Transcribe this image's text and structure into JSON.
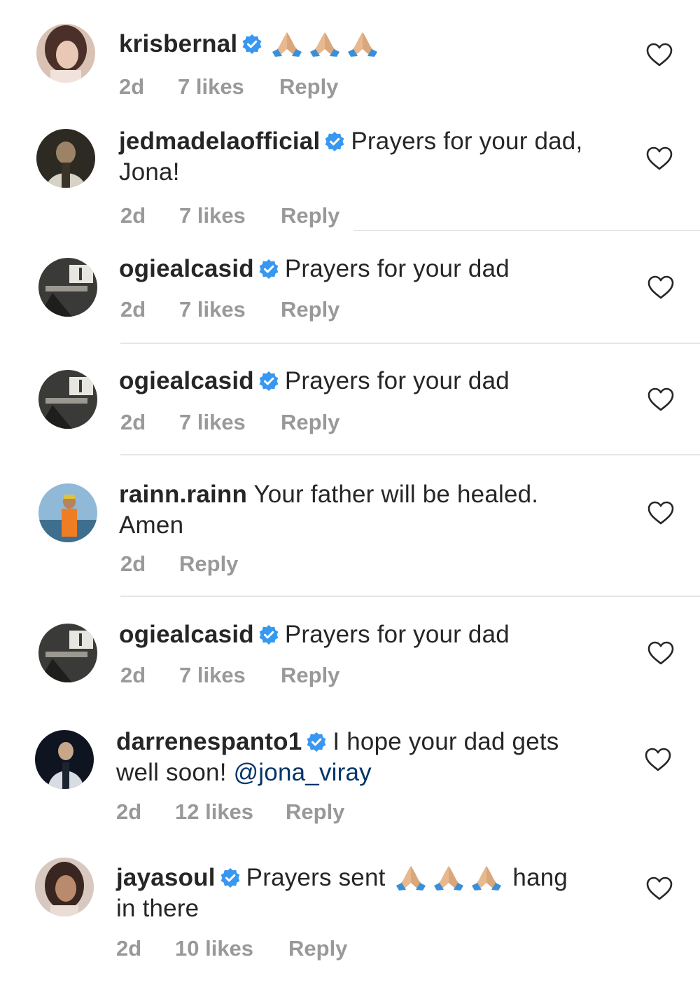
{
  "colors": {
    "username": "#262626",
    "meta": "#999999",
    "verified": "#3897f0",
    "mention": "#003569",
    "divider": "#e6e6e6"
  },
  "icons": {
    "verified": "verified-badge-icon",
    "like": "heart-outline-icon",
    "emoji": "folded-hands-emoji-icon"
  },
  "comments": [
    {
      "username": "krisbernal",
      "verified": true,
      "text": "",
      "emoji_count": 3,
      "time": "2d",
      "likes": "7 likes",
      "reply": "Reply"
    },
    {
      "username": "jedmadelaofficial",
      "verified": true,
      "text": "Prayers for your dad, Jona!",
      "time": "2d",
      "likes": "7 likes",
      "reply": "Reply"
    },
    {
      "username": "ogiealcasid",
      "verified": true,
      "text": "Prayers for your dad",
      "time": "2d",
      "likes": "7 likes",
      "reply": "Reply"
    },
    {
      "username": "ogiealcasid",
      "verified": true,
      "text": "Prayers for your dad",
      "time": "2d",
      "likes": "7 likes",
      "reply": "Reply"
    },
    {
      "username": "rainn.rainn",
      "verified": false,
      "text": "Your father will be healed. Amen",
      "time": "2d",
      "reply": "Reply"
    },
    {
      "username": "ogiealcasid",
      "verified": true,
      "text": "Prayers for your dad",
      "time": "2d",
      "likes": "7 likes",
      "reply": "Reply"
    },
    {
      "username": "darrenespanto1",
      "verified": true,
      "text": "I hope your dad gets well soon!",
      "mention": "@jona_viray",
      "time": "2d",
      "likes": "12 likes",
      "reply": "Reply"
    },
    {
      "username": "jayasoul",
      "verified": true,
      "text_before": "Prayers sent",
      "emoji_count": 3,
      "text_after": "hang in there",
      "time": "2d",
      "likes": "10 likes",
      "reply": "Reply"
    }
  ]
}
